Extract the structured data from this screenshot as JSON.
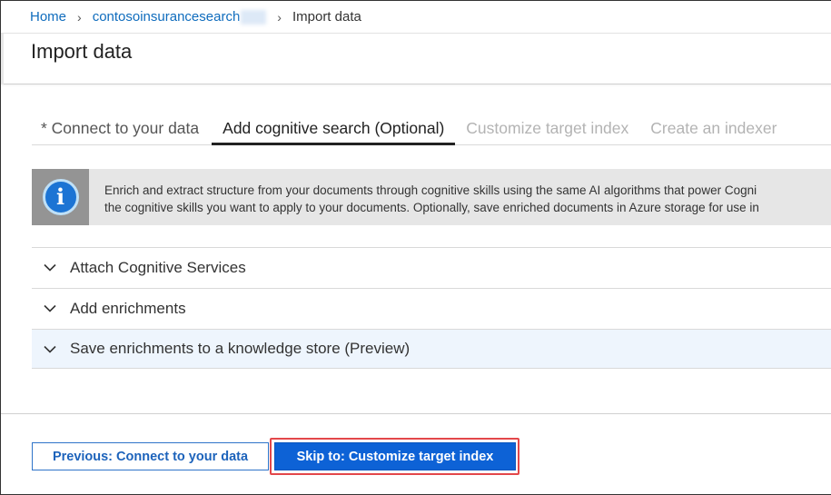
{
  "breadcrumb": {
    "home": "Home",
    "service": "contosoinsurancesearch",
    "current": "Import data"
  },
  "page": {
    "title": "Import data"
  },
  "tabs": [
    {
      "label": "* Connect to your data",
      "state": "normal"
    },
    {
      "label": "Add cognitive search (Optional)",
      "state": "active"
    },
    {
      "label": "Customize target index",
      "state": "disabled"
    },
    {
      "label": "Create an indexer",
      "state": "disabled"
    }
  ],
  "info": {
    "icon": "info-icon",
    "line1": "Enrich and extract structure from your documents through cognitive skills using the same AI algorithms that power Cogni",
    "line2": "the cognitive skills you want to apply to your documents. Optionally, save enriched documents in Azure storage for use in"
  },
  "sections": [
    {
      "label": "Attach Cognitive Services",
      "icon": "chevron-down-icon"
    },
    {
      "label": "Add enrichments",
      "icon": "chevron-down-icon"
    },
    {
      "label": "Save enrichments to a knowledge store (Preview)",
      "icon": "chevron-down-icon"
    }
  ],
  "footer": {
    "previous_label": "Previous: Connect to your data",
    "next_label": "Skip to: Customize target index"
  },
  "colors": {
    "link": "#0f6cbd",
    "primary": "#0d62d6",
    "highlight": "#e3474a",
    "info_bg": "#e6e6e6",
    "selected_section_bg": "#eef5fd"
  }
}
